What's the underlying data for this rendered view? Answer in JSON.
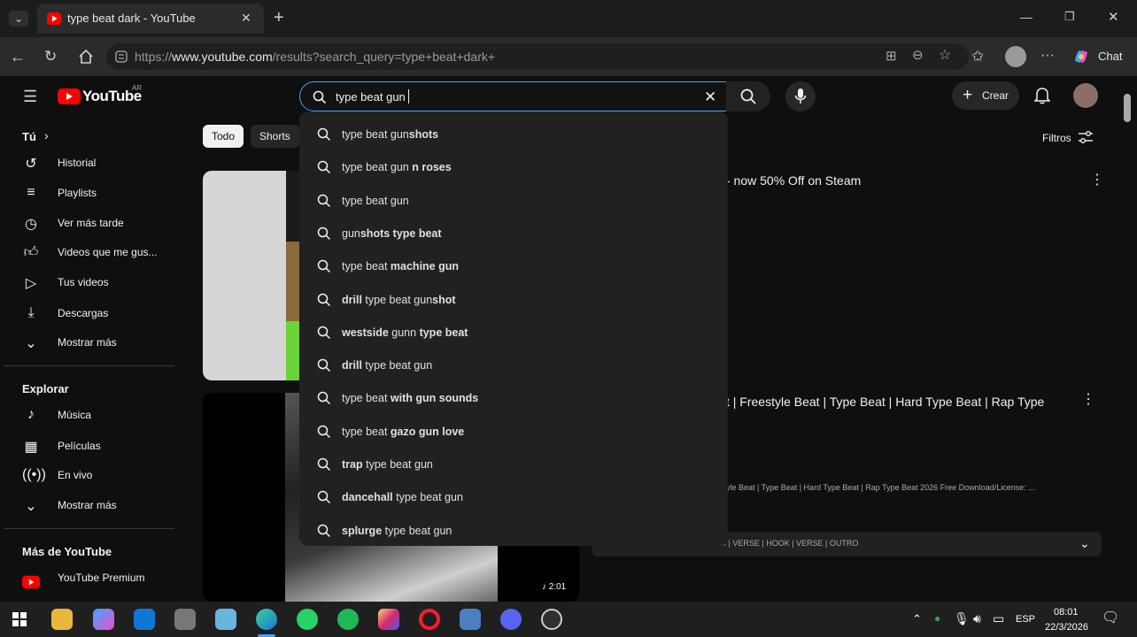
{
  "browser": {
    "tab_title": "type beat dark - YouTube",
    "url_prefix": "https://",
    "url_host": "www.youtube.com",
    "url_path": "/results?search_query=type+beat+dark+",
    "chat_label": "Chat"
  },
  "youtube": {
    "logo_text": "YouTube",
    "logo_region": "AR",
    "search_value": "type beat gun",
    "create_label": "Crear",
    "filters_label": "Filtros",
    "chips": [
      "Todo",
      "Shorts"
    ],
    "sidebar": {
      "you_label": "Tú",
      "items": [
        "Historial",
        "Playlists",
        "Ver más tarde",
        "Videos que me gus...",
        "Tus videos",
        "Descargas",
        "Mostrar más"
      ],
      "explore_label": "Explorar",
      "explore_items": [
        "Música",
        "Películas",
        "En vivo",
        "Mostrar más"
      ],
      "more_label": "Más de YouTube",
      "more_items": [
        "YouTube Premium"
      ]
    },
    "suggestions": [
      {
        "pre": "",
        "main": "type beat gun",
        "post": "shots"
      },
      {
        "pre": "",
        "main": "type beat gun",
        "post": " n roses"
      },
      {
        "pre": "",
        "main": "type beat gun",
        "post": ""
      },
      {
        "pre": "",
        "main": "gun",
        "post": "shots type beat"
      },
      {
        "pre": "",
        "main": "type beat",
        "post": " machine gun"
      },
      {
        "pre": "drill ",
        "main": "type beat gun",
        "post": "shot"
      },
      {
        "pre": "westside ",
        "main": "gunn",
        "post": " type beat"
      },
      {
        "pre": "drill ",
        "main": "type beat gun",
        "post": ""
      },
      {
        "pre": "",
        "main": "type beat",
        "post": " with gun sounds"
      },
      {
        "pre": "",
        "main": "type beat",
        "post": " gazo gun love"
      },
      {
        "pre": "trap ",
        "main": "type beat gun",
        "post": ""
      },
      {
        "pre": "dancehall ",
        "main": "type beat gun",
        "post": ""
      },
      {
        "pre": "splurge ",
        "main": "type beat gun",
        "post": ""
      }
    ],
    "results": {
      "r1_title": "- now 50% Off on Steam",
      "r2_title": "t | Freestyle Beat | Type Beat | Hard Type Beat | Rap Type",
      "r2_desc": "yle Beat | Type Beat | Hard Type Beat | Rap Type Beat 2026 Free Download/License: ...",
      "r2_chapters": "K | VERSE | HOOK | VERSE | OUTRO",
      "r2_duration": "2:01"
    }
  },
  "taskbar": {
    "lang": "ESP",
    "time": "08:01",
    "date": "22/3/2026"
  },
  "colors": {
    "accent_blue": "#3ea6ff",
    "youtube_red": "#ff0000"
  }
}
